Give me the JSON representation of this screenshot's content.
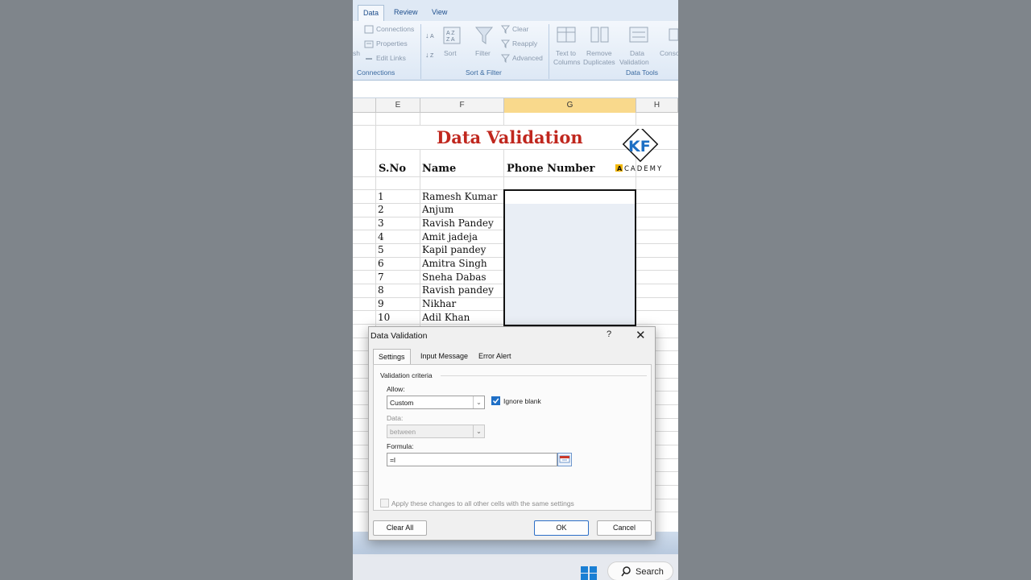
{
  "ribbon": {
    "tabs": [
      "Data",
      "Review",
      "View"
    ],
    "active_tab": "Data",
    "connections_group": {
      "label": "Connections",
      "items": [
        "Connections",
        "Properties",
        "Edit Links"
      ],
      "cut_label": "sh"
    },
    "sort_filter_group": {
      "label": "Sort & Filter",
      "sort_label": "Sort",
      "filter_label": "Filter",
      "clear_label": "Clear",
      "reapply_label": "Reapply",
      "advanced_label": "Advanced"
    },
    "data_tools_group": {
      "label": "Data Tools",
      "text_to_columns_1": "Text to",
      "text_to_columns_2": "Columns",
      "remove_dup_1": "Remove",
      "remove_dup_2": "Duplicates",
      "validation_1": "Data",
      "validation_2": "Validation",
      "consolidate": "Conso"
    }
  },
  "sheet": {
    "columns": [
      "E",
      "F",
      "G",
      "H"
    ],
    "selected_column": "G",
    "title": "Data Validation",
    "headers": {
      "sno": "S.No",
      "name": "Name",
      "phone": "Phone Number"
    },
    "rows": [
      {
        "sno": "1",
        "name": "Ramesh Kumar"
      },
      {
        "sno": "2",
        "name": "Anjum"
      },
      {
        "sno": "3",
        "name": "Ravish Pandey"
      },
      {
        "sno": "4",
        "name": "Amit jadeja"
      },
      {
        "sno": "5",
        "name": "Kapil pandey"
      },
      {
        "sno": "6",
        "name": "Amitra Singh"
      },
      {
        "sno": "7",
        "name": "Sneha Dabas"
      },
      {
        "sno": "8",
        "name": "Ravish pandey"
      },
      {
        "sno": "9",
        "name": "Nikhar"
      },
      {
        "sno": "10",
        "name": "Adil Khan"
      }
    ]
  },
  "logo": {
    "mark": "KF",
    "text": "ACADEMY"
  },
  "dialog": {
    "title": "Data Validation",
    "help": "?",
    "close": "✕",
    "tabs": [
      "Settings",
      "Input Message",
      "Error Alert"
    ],
    "active_tab": "Settings",
    "section_label": "Validation criteria",
    "allow_label": "Allow:",
    "allow_value": "Custom",
    "ignore_blank_label": "Ignore blank",
    "ignore_blank_checked": true,
    "data_label": "Data:",
    "data_value": "between",
    "formula_label": "Formula:",
    "formula_value": "=l",
    "apply_all_label": "Apply these changes to all other cells with the same settings",
    "clear_all_label": "Clear All",
    "ok_label": "OK",
    "cancel_label": "Cancel"
  },
  "taskbar": {
    "search_label": "Search"
  }
}
